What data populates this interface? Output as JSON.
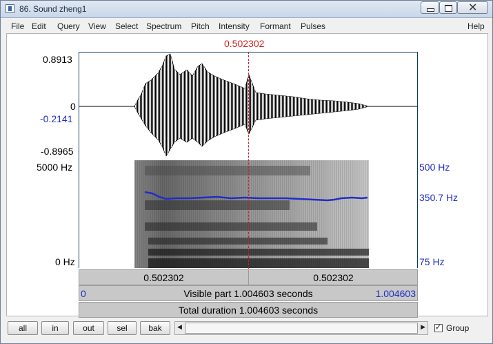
{
  "window": {
    "title": "86. Sound zheng1"
  },
  "menu": [
    "File",
    "Edit",
    "Query",
    "View",
    "Select",
    "Spectrum",
    "Pitch",
    "Intensity",
    "Formant",
    "Pulses",
    "Help"
  ],
  "cursor_time": "0.502302",
  "waveform": {
    "max_label": "0.8913",
    "zero_label": "0",
    "cursor_value_label": "-0.2141",
    "min_label": "-0.8965"
  },
  "spectrogram": {
    "freq_top_label": "5000 Hz",
    "freq_bottom_label": "0 Hz",
    "pitch_top_label": "500 Hz",
    "pitch_cursor_label": "350.7 Hz",
    "pitch_bottom_label": "75 Hz",
    "pitch_color": "#1f2ec5"
  },
  "time_bar": {
    "left_segment": "0.502302",
    "right_segment": "0.502302",
    "visible_start": "0",
    "visible_part": "Visible part 1.004603 seconds",
    "visible_end": "1.004603",
    "total_duration": "Total duration 1.004603 seconds"
  },
  "toolbar": {
    "all": "all",
    "in": "in",
    "out": "out",
    "sel": "sel",
    "bak": "bak",
    "group_label": "Group",
    "group_checked": true
  },
  "colors": {
    "cursor": "#d0201d",
    "axis_blue": "#1f2ec5",
    "frame": "#0b3f5d"
  }
}
